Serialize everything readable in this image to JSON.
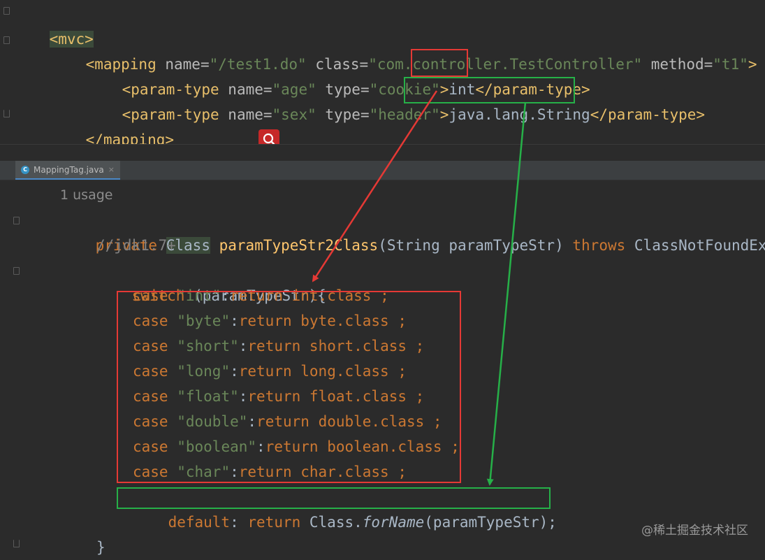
{
  "xml": {
    "line1": {
      "open": "<mvc>"
    },
    "line2": {
      "p1": "<mapping ",
      "a1": "name=",
      "v1": "\"/test1.do\"",
      "a2": " class=",
      "v2": "\"com.controller.TestController\"",
      "a3": " method=",
      "v3": "\"t1\"",
      "p2": ">"
    },
    "line3": {
      "p1": "<param-type ",
      "a1": "name=",
      "v1": "\"age\"",
      "a2": " type=",
      "v2": "\"cookie\"",
      "p2": ">",
      "content": "int",
      "close": "</param-type>"
    },
    "line4": {
      "p1": "<param-type ",
      "a1": "name=",
      "v1": "\"sex\"",
      "a2": " type=",
      "v2": "\"header\"",
      "p2": ">",
      "content": "java.lang.String",
      "close": "</param-type>"
    },
    "line5": {
      "close": "</mapping>"
    }
  },
  "tab": {
    "icon": "C",
    "filename": "MappingTag.java",
    "close": "×"
  },
  "java": {
    "usage": "1 usage",
    "signature": {
      "kw": "private",
      "type": "Class",
      "method": "paramTypeStr2Class",
      "paren": "(",
      "ptype": "String",
      "pname": " paramTypeStr)",
      "throws": "throws",
      "exc": "ClassNotFoundExce"
    },
    "comment": "//jdk1.7+",
    "switch": {
      "kw": "switch",
      "rest": " (paramTypeStr){"
    },
    "cases": [
      {
        "kw": "case",
        "str": "\"int\"",
        "ret": "return",
        "cls": "int",
        "dot": ".class",
        "end": " ;"
      },
      {
        "kw": "case",
        "str": "\"byte\"",
        "ret": "return",
        "cls": "byte",
        "dot": ".class",
        "end": " ;"
      },
      {
        "kw": "case",
        "str": "\"short\"",
        "ret": "return",
        "cls": "short",
        "dot": ".class",
        "end": " ;"
      },
      {
        "kw": "case",
        "str": "\"long\"",
        "ret": "return",
        "cls": "long",
        "dot": ".class",
        "end": " ;"
      },
      {
        "kw": "case",
        "str": "\"float\"",
        "ret": "return",
        "cls": "float",
        "dot": ".class",
        "end": " ;"
      },
      {
        "kw": "case",
        "str": "\"double\"",
        "ret": "return",
        "cls": "double",
        "dot": ".class",
        "end": " ;"
      },
      {
        "kw": "case",
        "str": "\"boolean\"",
        "ret": "return",
        "cls": "boolean",
        "dot": ".class",
        "end": " ;"
      },
      {
        "kw": "case",
        "str": "\"char\"",
        "ret": "return",
        "cls": "char",
        "dot": ".class",
        "end": " ;"
      }
    ],
    "default": {
      "kw": "default",
      "colon": ": ",
      "ret": "return",
      "cls": " Class.",
      "method": "forName",
      "args": "(paramTypeStr);"
    },
    "closing_brace": "}"
  },
  "watermark": "@稀土掘金技术社区",
  "colors": {
    "annotation_red": "#e53935",
    "annotation_green": "#26b048",
    "editor_bg": "#2b2b2b"
  }
}
